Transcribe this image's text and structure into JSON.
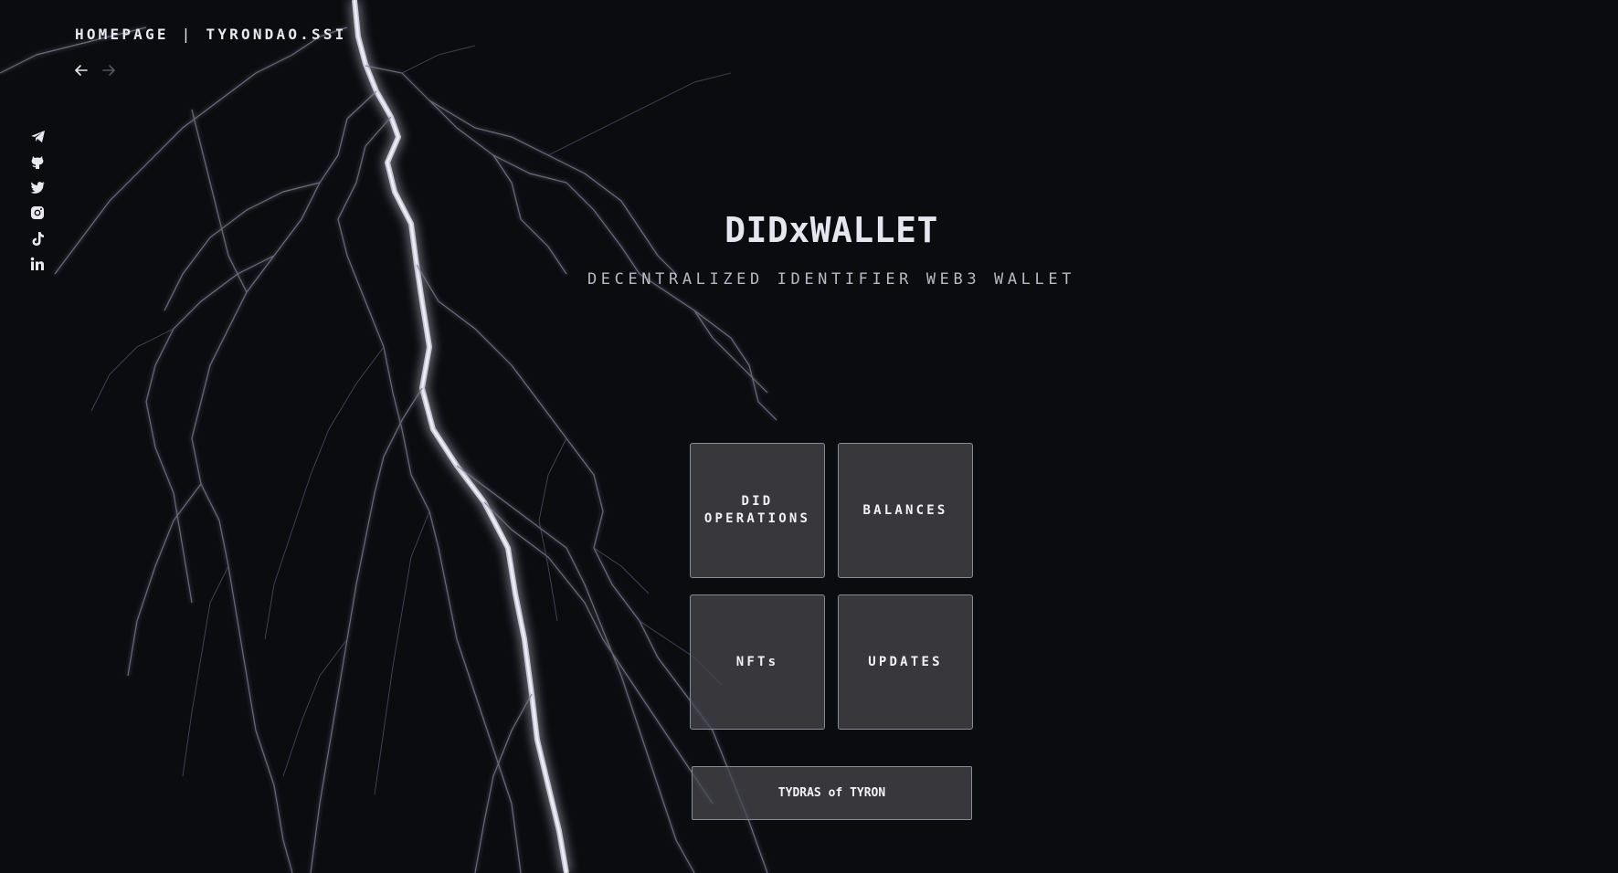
{
  "header": {
    "breadcrumb_home": "HOMEPAGE",
    "breadcrumb_separator": "|",
    "breadcrumb_site": "TYRONDAO.SSI"
  },
  "nav": {
    "back_icon": "arrow-left-icon",
    "forward_icon": "arrow-right-icon"
  },
  "socials": [
    {
      "icon": "telegram-icon"
    },
    {
      "icon": "github-icon"
    },
    {
      "icon": "twitter-icon"
    },
    {
      "icon": "instagram-icon"
    },
    {
      "icon": "tiktok-icon"
    },
    {
      "icon": "linkedin-icon"
    }
  ],
  "hero": {
    "title": "DIDxWALLET",
    "subtitle": "DECENTRALIZED IDENTIFIER WEB3 WALLET"
  },
  "tiles": {
    "did_operations_line1": "DID",
    "did_operations_line2": "OPERATIONS",
    "balances": "BALANCES",
    "nfts": "NFTs",
    "updates": "UPDATES"
  },
  "footer_button": {
    "label": "TYDRAS of TYRON"
  },
  "colors": {
    "background": "#0b0c10",
    "tile_fill": "#48484e",
    "tile_border": "#8a8a92",
    "text": "#e6e6ee"
  }
}
